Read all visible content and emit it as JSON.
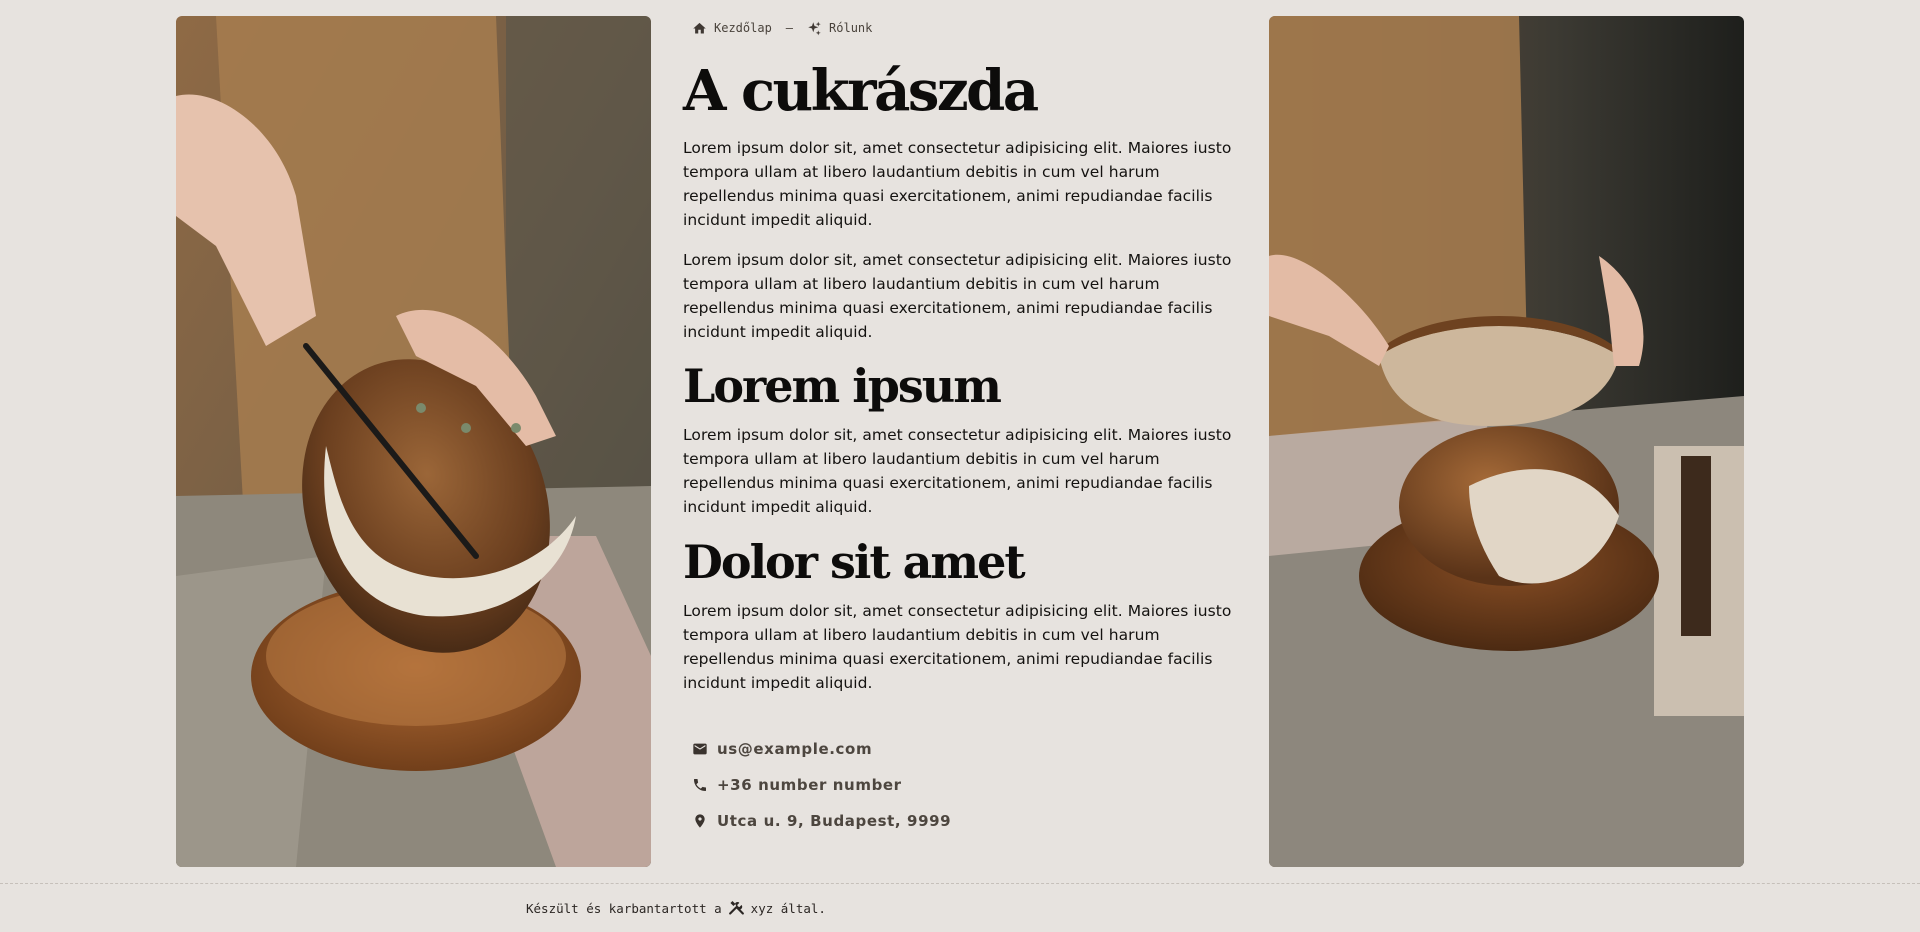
{
  "breadcrumb": {
    "home": {
      "label": "Kezdőlap",
      "icon": "home-icon"
    },
    "separator": "—",
    "current": {
      "label": "Rólunk",
      "icon": "sparkle-icon"
    }
  },
  "main": {
    "title": "A cukrászda",
    "paragraph_1": "Lorem ipsum dolor sit, amet consectetur adipisicing elit. Maiores iusto tempora ullam at libero laudantium debitis in cum vel harum repellendus minima quasi exercitationem, animi repudiandae facilis incidunt impedit aliquid.",
    "paragraph_2": "Lorem ipsum dolor sit, amet consectetur adipisicing elit. Maiores iusto tempora ullam at libero laudantium debitis in cum vel harum repellendus minima quasi exercitationem, animi repudiandae facilis incidunt impedit aliquid.",
    "section_1_title": "Lorem ipsum",
    "paragraph_3": "Lorem ipsum dolor sit, amet consectetur adipisicing elit. Maiores iusto tempora ullam at libero laudantium debitis in cum vel harum repellendus minima quasi exercitationem, animi repudiandae facilis incidunt impedit aliquid.",
    "section_2_title": "Dolor sit amet",
    "paragraph_4": "Lorem ipsum dolor sit, amet consectetur adipisicing elit. Maiores iusto tempora ullam at libero laudantium debitis in cum vel harum repellendus minima quasi exercitationem, animi repudiandae facilis incidunt impedit aliquid."
  },
  "contact": {
    "email": "us@example.com",
    "phone": "+36 number number",
    "address": "Utca u. 9, Budapest, 9999"
  },
  "footer": {
    "prefix": "Készült és karbantartott a",
    "icon": "tools-icon",
    "suffix": "xyz által."
  },
  "images": {
    "left": "bread-cutting-photo",
    "right": "bread-halves-photo"
  },
  "colors": {
    "background": "#e7e3df",
    "text": "#141210",
    "muted": "#4d463f"
  }
}
